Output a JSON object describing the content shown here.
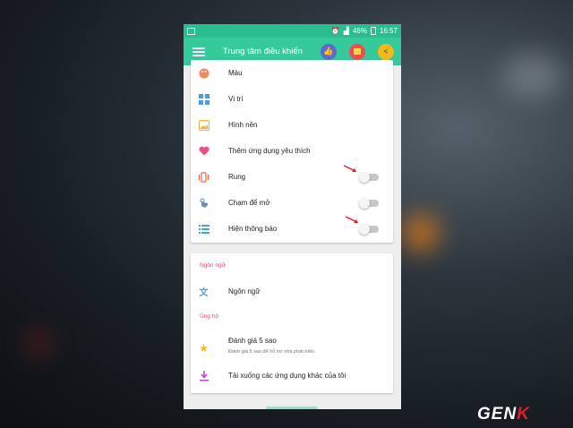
{
  "status_bar": {
    "battery": "46%",
    "time": "16:57"
  },
  "app_bar": {
    "title": "Trung tâm điều khiển"
  },
  "settings": {
    "items": [
      {
        "label": "Màu",
        "icon": "palette-icon"
      },
      {
        "label": "Vị trí",
        "icon": "grid-position-icon"
      },
      {
        "label": "Hình nền",
        "icon": "image-icon"
      },
      {
        "label": "Thêm ứng dụng yêu thích",
        "icon": "heart-icon"
      },
      {
        "label": "Rung",
        "icon": "vibrate-icon",
        "toggle": false
      },
      {
        "label": "Chạm để mở",
        "icon": "touch-icon",
        "toggle": false
      },
      {
        "label": "Hiện thông báo",
        "icon": "list-icon",
        "toggle": false
      }
    ]
  },
  "language": {
    "header": "Ngôn ngữ",
    "item_label": "Ngôn ngữ"
  },
  "support": {
    "header": "Ủng hộ",
    "rate_label": "Đánh giá 5 sao",
    "rate_sub": "Đánh giá 5 sao để hỗ trợ nhà phát triển.",
    "download_label": "Tải xuống các ứng dụng khác của tôi"
  },
  "watermark": {
    "left": "GEN",
    "right": "K"
  },
  "colors": {
    "accent": "#36c999",
    "section_header": "#e8436f"
  }
}
